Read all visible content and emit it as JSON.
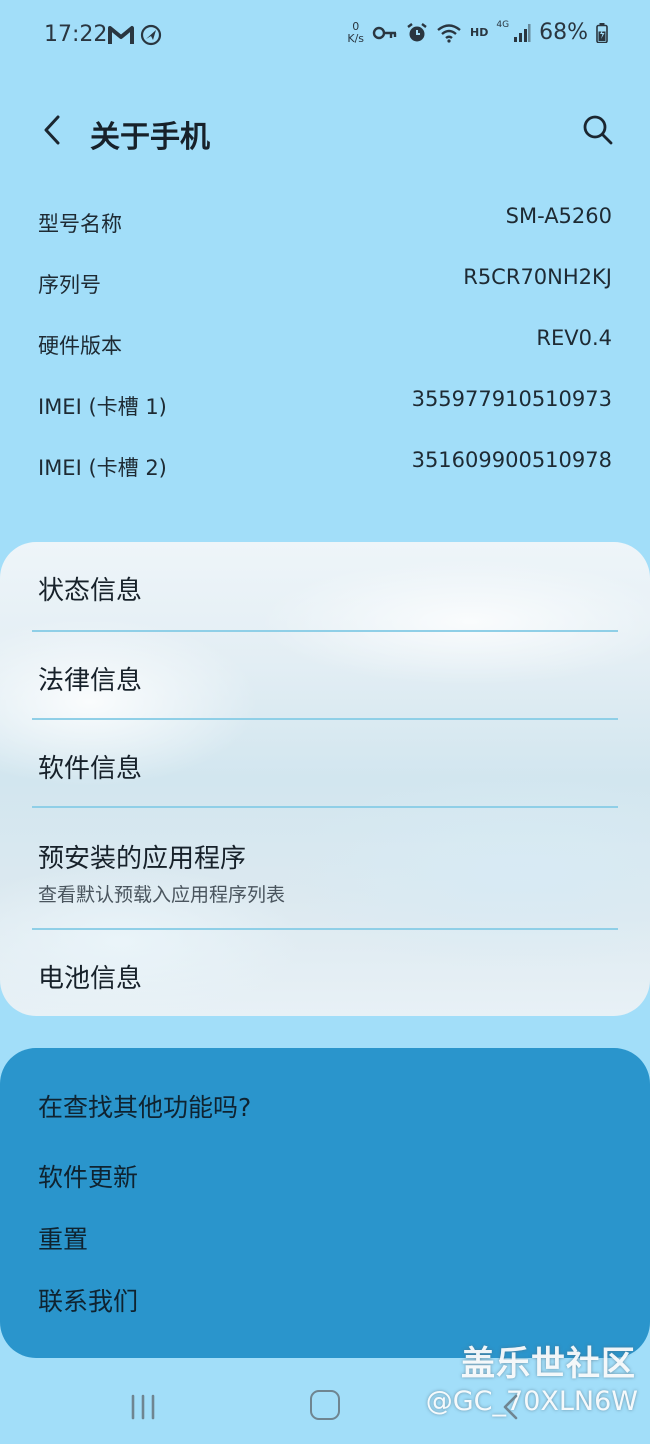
{
  "status_bar": {
    "time": "17:22",
    "left_icons": [
      "gmail-icon",
      "location-arrow-icon"
    ],
    "net_speed_value": "0",
    "net_speed_unit": "K/s",
    "right_icons": [
      "vpn-key-icon",
      "alarm-icon",
      "wifi-icon"
    ],
    "hd_label": "HD",
    "network_label": "4G",
    "battery_percent": "68%",
    "battery_level": 0.68
  },
  "header": {
    "title": "关于手机",
    "back_icon": "chevron-left-icon",
    "search_icon": "search-icon"
  },
  "device_info": [
    {
      "label": "型号名称",
      "value": "SM-A5260"
    },
    {
      "label": "序列号",
      "value": "R5CR70NH2KJ"
    },
    {
      "label": "硬件版本",
      "value": "REV0.4"
    },
    {
      "label": "IMEI (卡槽 1)",
      "value": "355977910510973"
    },
    {
      "label": "IMEI (卡槽 2)",
      "value": "351609900510978"
    }
  ],
  "menu": {
    "items": [
      {
        "label": "状态信息",
        "sublabel": ""
      },
      {
        "label": "法律信息",
        "sublabel": ""
      },
      {
        "label": "软件信息",
        "sublabel": ""
      },
      {
        "label": "预安装的应用程序",
        "sublabel": "查看默认预载入应用程序列表"
      },
      {
        "label": "电池信息",
        "sublabel": ""
      }
    ]
  },
  "find_more": {
    "title": "在查找其他功能吗?",
    "links": [
      "软件更新",
      "重置",
      "联系我们"
    ]
  },
  "nav_bar": {
    "icons": [
      "recent-apps-icon",
      "home-icon",
      "back-icon"
    ]
  },
  "watermark": {
    "brand": "盖乐世社区",
    "user": "@GC_70XLN6W"
  },
  "colors": {
    "background": "#a2def9",
    "find_card": "#2a95cc",
    "divider": "#8fcfe7"
  }
}
